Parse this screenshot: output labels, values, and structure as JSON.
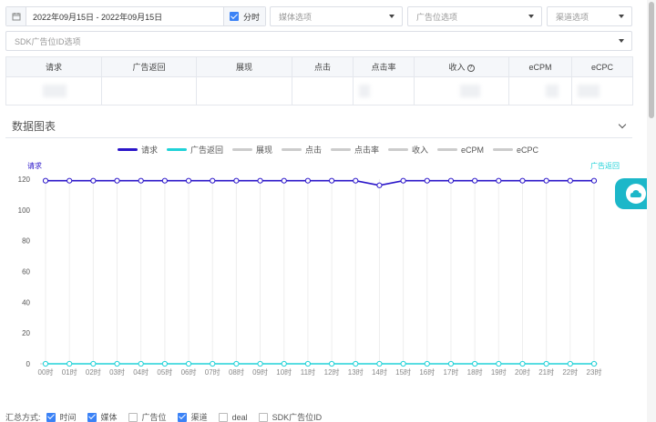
{
  "filters": {
    "date_range": "2022年09月15日 - 2022年09月15日",
    "hourly_label": "分时",
    "hourly_checked": true,
    "media_placeholder": "媒体选项",
    "adpos_placeholder": "广告位选项",
    "channel_placeholder": "渠道选项",
    "sdk_placeholder": "SDK广告位ID选项"
  },
  "table": {
    "headers": [
      "请求",
      "广告返回",
      "展现",
      "点击",
      "点击率",
      "收入",
      "eCPM",
      "eCPC"
    ],
    "revenue_help_icon": "question-circle-icon"
  },
  "section": {
    "title": "数据图表"
  },
  "legend": [
    {
      "name": "请求",
      "color": "#2b16c9"
    },
    {
      "name": "广告返回",
      "color": "#20d2d8"
    },
    {
      "name": "展现",
      "color": "#cccccc"
    },
    {
      "name": "点击",
      "color": "#cccccc"
    },
    {
      "name": "点击率",
      "color": "#cccccc"
    },
    {
      "name": "收入",
      "color": "#cccccc"
    },
    {
      "name": "eCPM",
      "color": "#cccccc"
    },
    {
      "name": "eCPC",
      "color": "#cccccc"
    }
  ],
  "chart_data": {
    "type": "line",
    "x": [
      "00时",
      "01时",
      "02时",
      "03时",
      "04时",
      "05时",
      "06时",
      "07时",
      "08时",
      "09时",
      "10时",
      "11时",
      "12时",
      "13时",
      "14时",
      "15时",
      "16时",
      "17时",
      "18时",
      "19时",
      "20时",
      "21时",
      "22时",
      "23时"
    ],
    "ylim": [
      0,
      120
    ],
    "yticks": [
      0,
      20,
      40,
      60,
      80,
      100,
      120
    ],
    "left_axis_label": "请求",
    "right_axis_label": "广告返回",
    "series": [
      {
        "name": "请求",
        "color": "#2b16c9",
        "values": [
          119,
          119,
          119,
          119,
          119,
          119,
          119,
          119,
          119,
          119,
          119,
          119,
          119,
          119,
          116,
          119,
          119,
          119,
          119,
          119,
          119,
          119,
          119,
          119
        ]
      },
      {
        "name": "广告返回",
        "color": "#20d2d8",
        "values": [
          0,
          0,
          0,
          0,
          0,
          0,
          0,
          0,
          0,
          0,
          0,
          0,
          0,
          0,
          0,
          0,
          0,
          0,
          0,
          0,
          0,
          0,
          0,
          0
        ]
      }
    ]
  },
  "summary": {
    "label": "汇总方式:",
    "options": [
      {
        "label": "时间",
        "checked": true
      },
      {
        "label": "媒体",
        "checked": true
      },
      {
        "label": "广告位",
        "checked": false
      },
      {
        "label": "渠道",
        "checked": true
      },
      {
        "label": "deal",
        "checked": false
      },
      {
        "label": "SDK广告位ID",
        "checked": false
      }
    ]
  }
}
